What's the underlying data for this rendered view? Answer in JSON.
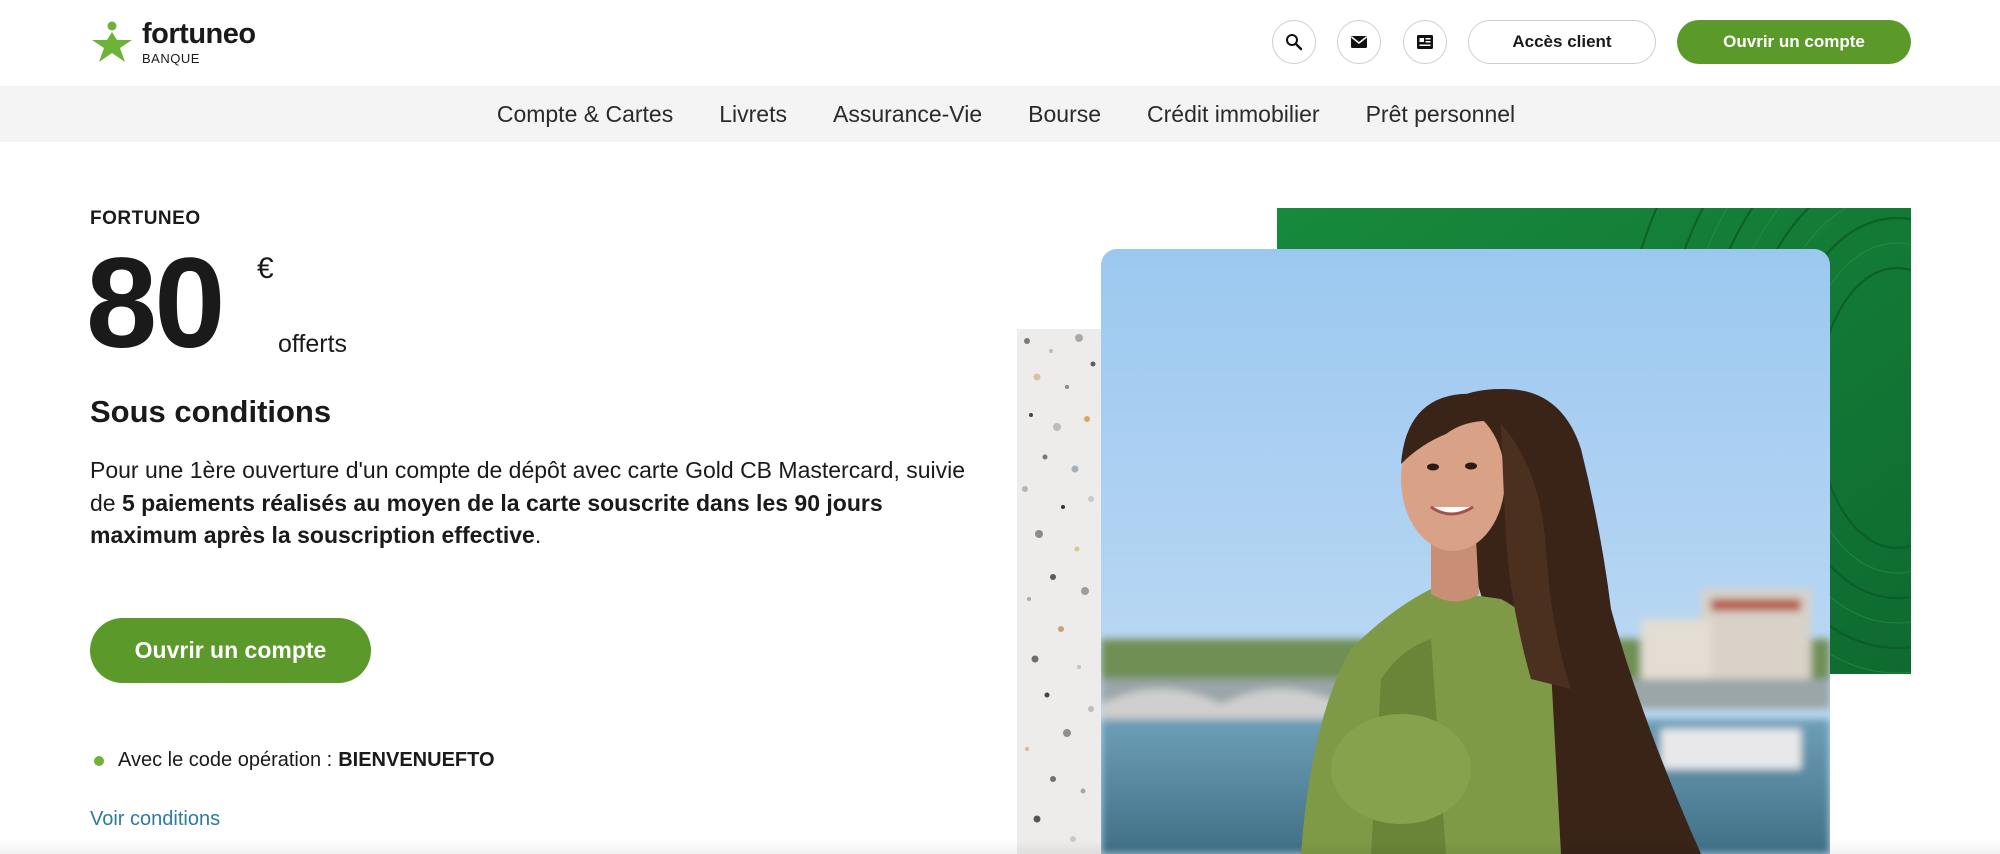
{
  "header": {
    "logo": {
      "name": "fortuneo",
      "sub": "BANQUE"
    },
    "icons": [
      "search-icon",
      "mail-icon",
      "news-icon"
    ],
    "client_access": "Accès client",
    "open_account": "Ouvrir un compte"
  },
  "nav": {
    "items": [
      {
        "label": "Compte & Cartes"
      },
      {
        "label": "Livrets"
      },
      {
        "label": "Assurance-Vie"
      },
      {
        "label": "Bourse"
      },
      {
        "label": "Crédit immobilier"
      },
      {
        "label": "Prêt personnel"
      }
    ]
  },
  "hero": {
    "eyebrow": "FORTUNEO",
    "amount": "80",
    "currency": "€",
    "offered": "offerts",
    "title": "Sous conditions",
    "desc_part1": "Pour une 1ère ouverture d'un compte de dépôt avec carte Gold CB Mastercard, suivie de ",
    "desc_bold": "5 paiements réalisés au moyen de la carte souscrite dans les 90 jours maximum après la souscription effective",
    "desc_end": ".",
    "cta": "Ouvrir un compte",
    "code_label": "Avec le code opération :",
    "code_value": "BIENVENUEFTO",
    "conditions_link": "Voir conditions"
  },
  "colors": {
    "brand_green": "#5b9a2a",
    "dark_green_panel": "#1d7a3a",
    "link_blue": "#2c7ba0",
    "nav_bg": "#f4f4f4"
  }
}
